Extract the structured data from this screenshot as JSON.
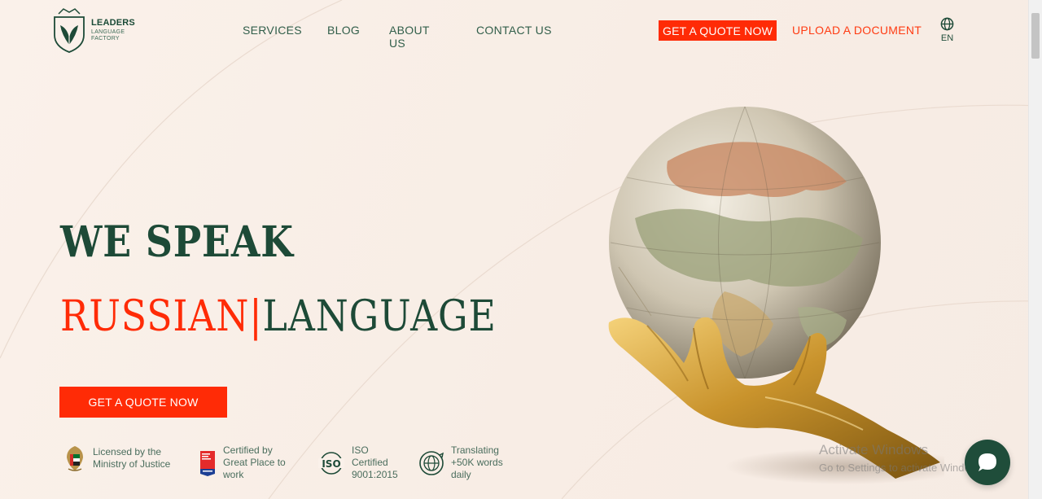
{
  "brand": {
    "name_line1": "LEADERS",
    "name_line2": "LANGUAGE",
    "name_line3": "FACTORY"
  },
  "nav": {
    "items": [
      {
        "label": "SERVICES"
      },
      {
        "label": "BLOG"
      },
      {
        "label": "ABOUT US"
      },
      {
        "label": "CONTACT US"
      }
    ],
    "quote_button": "GET A QUOTE NOW",
    "upload_link": "UPLOAD A DOCUMENT",
    "language": {
      "icon": "globe-icon",
      "code": "EN"
    }
  },
  "hero": {
    "line1": "WE SPEAK",
    "accent_word": "RUSSIAN",
    "separator": "|",
    "rest_word": "LANGUAGE",
    "cta_button": "GET A QUOTE NOW"
  },
  "badges": [
    {
      "icon": "emblem-icon",
      "text": "Licensed by the Ministry of Justice"
    },
    {
      "icon": "great-place-icon",
      "text": "Certified by Great Place to work"
    },
    {
      "icon": "iso-icon",
      "text": "ISO Certified 9001:2015"
    },
    {
      "icon": "translate-globe-icon",
      "text": "Translating +50K words daily"
    }
  ],
  "watermark": {
    "line1": "Activate Windows",
    "line2": "Go to Settings to activate Windows."
  },
  "chat": {
    "icon": "chat-icon"
  },
  "colors": {
    "accent": "#ff2b06",
    "brand_green": "#1d4a37",
    "background": "#faf1ea"
  }
}
